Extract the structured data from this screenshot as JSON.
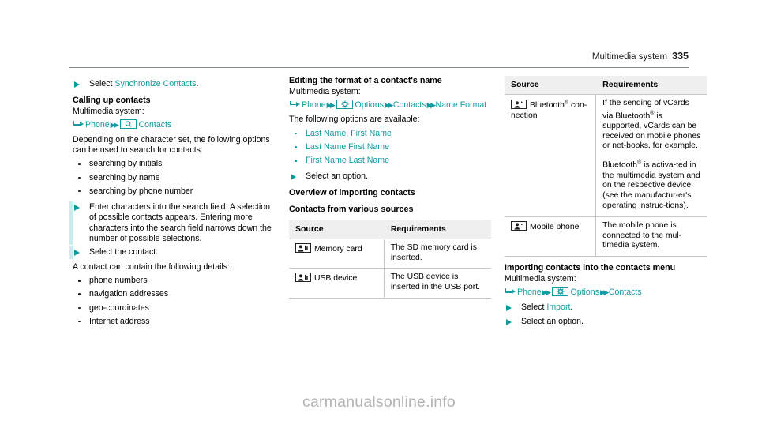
{
  "header": {
    "title": "Multimedia system",
    "page_number": "335"
  },
  "colors": {
    "accent_teal": "#0f9ba0",
    "marker_teal": "#089a9e",
    "highlight_bar": "#c9edee",
    "table_header_bg": "#efefef",
    "table_border": "#c6c6c6",
    "watermark": "#b3b3b3"
  },
  "left_column": {
    "step_select_sync": {
      "prefix": "Select ",
      "link": "Synchronize Contacts",
      "suffix": "."
    },
    "heading_calling": "Calling up contacts",
    "multimedia_label": "Multimedia system:",
    "path_phone_contacts": {
      "item1": "Phone",
      "icon": "search-icon",
      "item2": "Contacts"
    },
    "intro": "Depending on the character set, the following options can be used to search for contacts:",
    "search_options": [
      "searching by initials",
      "searching by name",
      "searching by phone number"
    ],
    "step_enter_chars": "Enter characters into the search field. A selection of possible contacts appears. Entering more characters into the search field narrows down the number of possible selections.",
    "step_select_contact": "Select the contact.",
    "details_intro": "A contact can contain the following details:",
    "details": [
      "phone numbers",
      "navigation addresses",
      "geo-coordinates",
      "Internet address"
    ]
  },
  "middle_column": {
    "heading_editing": "Editing the format of a contact's name",
    "multimedia_label": "Multimedia system:",
    "path_name_format": {
      "item1": "Phone",
      "icon": "gear-icon",
      "item2": "Options",
      "item3": "Contacts",
      "item4": "Name Format"
    },
    "options_intro": "The following options are available:",
    "name_format_options": [
      "Last Name, First Name",
      "Last Name First Name",
      "First Name Last Name"
    ],
    "step_select_option": "Select an option.",
    "heading_overview": "Overview of importing contacts",
    "heading_sources": "Contacts from various sources",
    "table": {
      "columns": [
        "Source",
        "Requirements"
      ],
      "rows": [
        {
          "icon": "contact-card-icon",
          "source": "Memory card",
          "requirements": "The SD memory card is inserted."
        },
        {
          "icon": "contact-card-icon",
          "source": "USB device",
          "requirements": "The USB device is inserted in the USB port."
        }
      ]
    }
  },
  "right_column": {
    "table": {
      "columns": [
        "Source",
        "Requirements"
      ],
      "rows": [
        {
          "icon": "contact-card-icon",
          "source_pre": "Bluetooth",
          "source_sup": "®",
          "source_post": " con-nection",
          "requirements_p1_pre": "If the sending of vCards via Bluetooth",
          "requirements_p1_sup": "®",
          "requirements_p1_post": " is supported, vCards can be received on mobile phones or net-books, for example.",
          "requirements_p2_pre": "Bluetooth",
          "requirements_p2_sup": "®",
          "requirements_p2_post": " is activa-ted in the multimedia system and on the respective device (see the manufactur-er's operating instruc-tions)."
        },
        {
          "icon": "contact-card-icon",
          "source": "Mobile phone",
          "requirements": "The mobile phone is connected to the mul-timedia system."
        }
      ]
    },
    "heading_importing": "Importing contacts into the contacts menu",
    "multimedia_label": "Multimedia system:",
    "path_import": {
      "item1": "Phone",
      "icon": "gear-icon",
      "item2": "Options",
      "item3": "Contacts"
    },
    "step_select_import": {
      "prefix": "Select ",
      "link": "Import",
      "suffix": "."
    },
    "step_select_option": "Select an option."
  },
  "watermark": "carmanualsonline.info"
}
